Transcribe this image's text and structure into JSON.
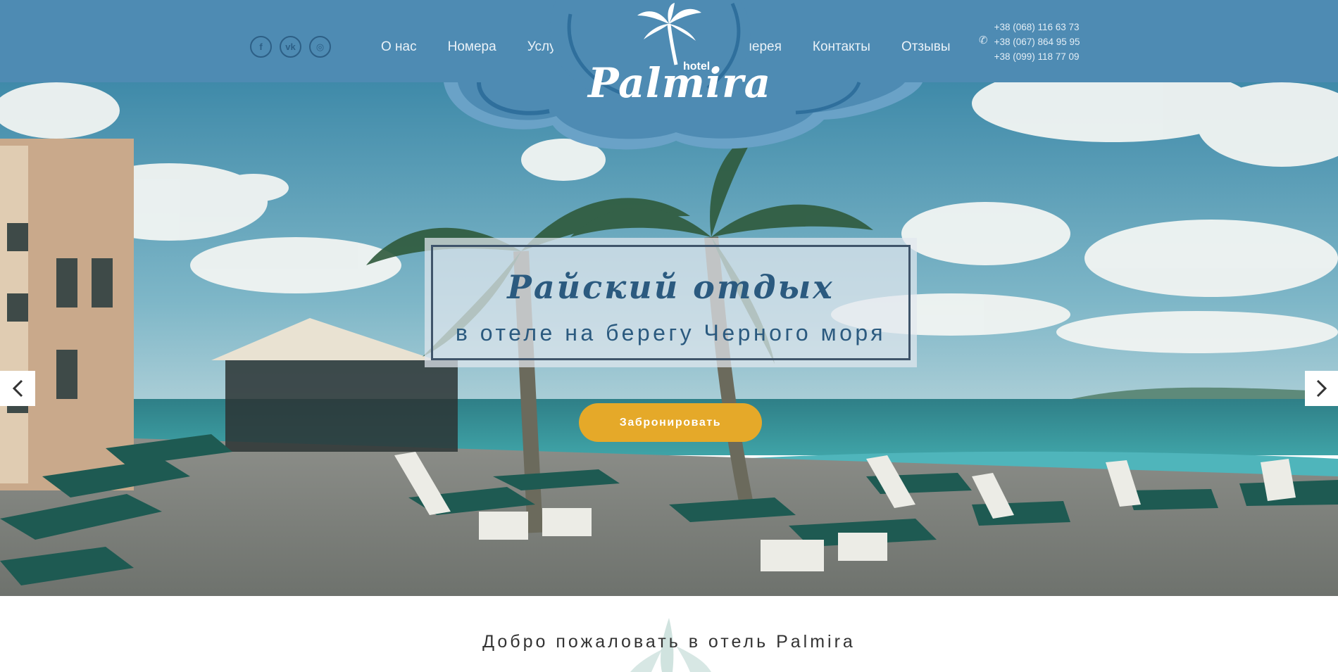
{
  "header": {
    "social": [
      {
        "name": "facebook-icon",
        "glyph": "f"
      },
      {
        "name": "vk-icon",
        "glyph": "vk"
      },
      {
        "name": "instagram-icon",
        "glyph": "◎"
      }
    ],
    "nav_left": [
      {
        "label": "О нас"
      },
      {
        "label": "Номера"
      },
      {
        "label": "Услуги"
      }
    ],
    "nav_right": [
      {
        "label": "Галерея"
      },
      {
        "label": "Контакты"
      },
      {
        "label": "Отзывы"
      }
    ],
    "phones": [
      "+38 (068) 116 63 73",
      "+38 (067) 864 95 95",
      "+38 (099) 118 77 09"
    ],
    "logo": {
      "name": "Palmira",
      "tag": "hotel"
    }
  },
  "hero": {
    "title": "Райский отдых",
    "subtitle": "в отеле на берегу Черного моря",
    "cta": "Забронировать"
  },
  "welcome": "Добро пожаловать в отель Palmira",
  "colors": {
    "header_bg": "#4e8bb3",
    "accent": "#e5a929",
    "title_text": "#2b5a7f"
  }
}
